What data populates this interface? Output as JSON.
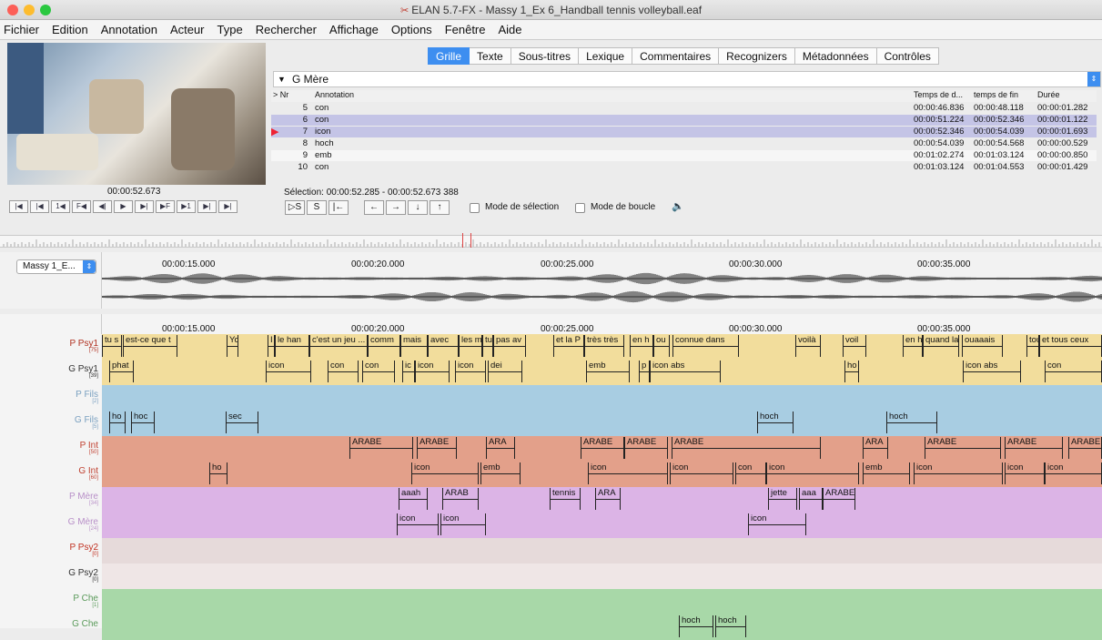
{
  "window": {
    "title": "ELAN 5.7-FX - Massy 1_Ex 6_Handball tennis volleyball.eaf"
  },
  "menu": [
    "Fichier",
    "Edition",
    "Annotation",
    "Acteur",
    "Type",
    "Rechercher",
    "Affichage",
    "Options",
    "Fenêtre",
    "Aide"
  ],
  "tabs": [
    "Grille",
    "Texte",
    "Sous-titres",
    "Lexique",
    "Commentaires",
    "Recognizers",
    "Métadonnées",
    "Contrôles"
  ],
  "grid": {
    "tier": "G Mère",
    "headers": {
      "sort": "> Nr",
      "annotation": "Annotation",
      "begin": "Temps de d...",
      "end": "temps de fin",
      "duration": "Durée"
    },
    "rows": [
      {
        "nr": "5",
        "annotation": "con",
        "begin": "00:00:46.836",
        "end": "00:00:48.118",
        "duration": "00:00:01.282"
      },
      {
        "nr": "6",
        "annotation": "con",
        "begin": "00:00:51.224",
        "end": "00:00:52.346",
        "duration": "00:00:01.122"
      },
      {
        "nr": "7",
        "annotation": "icon",
        "begin": "00:00:52.346",
        "end": "00:00:54.039",
        "duration": "00:00:01.693"
      },
      {
        "nr": "8",
        "annotation": "hoch",
        "begin": "00:00:54.039",
        "end": "00:00:54.568",
        "duration": "00:00:00.529"
      },
      {
        "nr": "9",
        "annotation": "emb",
        "begin": "00:01:02.274",
        "end": "00:01:03.124",
        "duration": "00:00:00.850"
      },
      {
        "nr": "10",
        "annotation": "con",
        "begin": "00:01:03.124",
        "end": "00:01:04.553",
        "duration": "00:00:01.429"
      }
    ]
  },
  "player": {
    "timecode": "00:00:52.673"
  },
  "selection": {
    "text": "Sélection: 00:00:52.285 - 00:00:52.673  388"
  },
  "modes": {
    "selection": "Mode de sélection",
    "loop": "Mode de boucle"
  },
  "controls": [
    "|◀",
    "|◀",
    "1◀",
    "F◀",
    "◀|",
    "▶",
    "▶|",
    "▶F",
    "▶1",
    "▶|",
    "▶|"
  ],
  "selbuttons": [
    "▷S",
    "S",
    "|←",
    "←",
    "→",
    "↓",
    "↑"
  ],
  "media": {
    "name": "Massy 1_E..."
  },
  "timeline": {
    "ticks": [
      "00:00:15.000",
      "00:00:20.000",
      "00:00:25.000",
      "00:00:30.000",
      "00:00:35.000"
    ]
  },
  "tiers": [
    {
      "name": "P Psy1",
      "count": "[75]",
      "color": "#f2dd9c",
      "label_color": "#b03020",
      "anns": [
        [
          "tu s",
          0,
          22
        ],
        [
          "est-ce que t",
          23,
          83
        ],
        [
          "Yo",
          137,
          150
        ],
        [
          "I",
          182,
          190
        ],
        [
          "le han",
          190,
          228
        ],
        [
          "c'est un jeu ...",
          228,
          292
        ],
        [
          "comm",
          292,
          328
        ],
        [
          "mais",
          328,
          358
        ],
        [
          "avec",
          358,
          392
        ],
        [
          "les m",
          392,
          418
        ],
        [
          "tu",
          418,
          430
        ],
        [
          "pas av",
          430,
          466
        ],
        [
          "et la P",
          496,
          530
        ],
        [
          "très très",
          530,
          574
        ],
        [
          "en h",
          580,
          606
        ],
        [
          "ou",
          606,
          624
        ],
        [
          "connue dans",
          627,
          700
        ],
        [
          "voilà",
          762,
          790
        ],
        [
          "voil",
          814,
          840
        ],
        [
          "en h",
          880,
          902
        ],
        [
          "quand la",
          902,
          942
        ],
        [
          "ouaaais",
          945,
          990
        ],
        [
          "tous",
          1016,
          1030
        ],
        [
          "et tous ceux",
          1030,
          1099
        ]
      ]
    },
    {
      "name": "G Psy1",
      "count": "[39]",
      "color": "#f2dd9c",
      "label_color": "#333",
      "anns": [
        [
          "phat",
          8,
          35
        ],
        [
          "icon",
          180,
          230
        ],
        [
          "con",
          248,
          282
        ],
        [
          "con",
          286,
          322
        ],
        [
          "ic",
          330,
          344
        ],
        [
          "icon",
          344,
          382
        ],
        [
          "icon",
          388,
          422
        ],
        [
          "dei",
          424,
          462
        ],
        [
          "emb",
          532,
          580
        ],
        [
          "p",
          590,
          602
        ],
        [
          "icon abs",
          602,
          680
        ],
        [
          "ho",
          816,
          832
        ],
        [
          "icon abs",
          946,
          1010
        ],
        [
          "con",
          1036,
          1099
        ]
      ]
    },
    {
      "name": "P Fils",
      "count": "[2]",
      "color": "#a8cde2",
      "label_color": "#7aa0c0",
      "anns": []
    },
    {
      "name": "G Fils",
      "count": "[5]",
      "color": "#a8cde2",
      "label_color": "#7aa0c0",
      "anns": [
        [
          "ho",
          8,
          26
        ],
        [
          "hoc",
          32,
          58
        ],
        [
          "sec",
          136,
          172
        ],
        [
          "hoch",
          720,
          760
        ],
        [
          "hoch",
          862,
          918
        ]
      ]
    },
    {
      "name": "P Int",
      "count": "[50]",
      "color": "#e3a08a",
      "label_color": "#c04030",
      "anns": [
        [
          "ARABE",
          272,
          342
        ],
        [
          "ARABE",
          346,
          390
        ],
        [
          "ARA",
          422,
          454
        ],
        [
          "ARABE",
          526,
          574
        ],
        [
          "ARABE",
          574,
          622
        ],
        [
          "ARABE",
          626,
          790
        ],
        [
          "ARA",
          836,
          864
        ],
        [
          "ARABE",
          904,
          988
        ],
        [
          "ARABE",
          992,
          1056
        ],
        [
          "ARABE",
          1062,
          1099
        ]
      ]
    },
    {
      "name": "G Int",
      "count": "[60]",
      "color": "#e3a08a",
      "label_color": "#c04030",
      "anns": [
        [
          "ho",
          118,
          138
        ],
        [
          "icon",
          340,
          414
        ],
        [
          "emb",
          416,
          460
        ],
        [
          "icon",
          534,
          622
        ],
        [
          "icon",
          624,
          694
        ],
        [
          "con",
          696,
          730
        ],
        [
          "icon",
          730,
          832
        ],
        [
          "emb",
          836,
          888
        ],
        [
          "icon",
          892,
          990
        ],
        [
          "icon",
          992,
          1036
        ],
        [
          "icon",
          1036,
          1099
        ]
      ]
    },
    {
      "name": "P Mère",
      "count": "[34]",
      "color": "#dcb4e6",
      "label_color": "#b890c8",
      "anns": [
        [
          "aaah",
          326,
          358
        ],
        [
          "ARAB",
          374,
          414
        ],
        [
          "tennis",
          492,
          526
        ],
        [
          "ARA",
          542,
          570
        ],
        [
          "jette",
          732,
          764
        ],
        [
          "aaa",
          766,
          792
        ],
        [
          "ARABE",
          792,
          828
        ]
      ]
    },
    {
      "name": "G Mère",
      "count": "[24]",
      "color": "#dcb4e6",
      "label_color": "#b890c8",
      "anns": [
        [
          "icon",
          324,
          370
        ],
        [
          "icon",
          372,
          422
        ],
        [
          "icon",
          710,
          774
        ]
      ]
    },
    {
      "name": "P Psy2",
      "count": "[0]",
      "color": "#e6dada",
      "label_color": "#c03020",
      "anns": []
    },
    {
      "name": "G Psy2",
      "count": "[0]",
      "color": "#efe6e6",
      "label_color": "#333",
      "anns": []
    },
    {
      "name": "P Che",
      "count": "[1]",
      "color": "#a8d8a8",
      "label_color": "#5a9a5a",
      "anns": []
    },
    {
      "name": "G Che",
      "count": "",
      "color": "#a8d8a8",
      "label_color": "#5a9a5a",
      "anns": [
        [
          "hoch",
          634,
          672
        ],
        [
          "hoch",
          674,
          708
        ]
      ]
    }
  ]
}
